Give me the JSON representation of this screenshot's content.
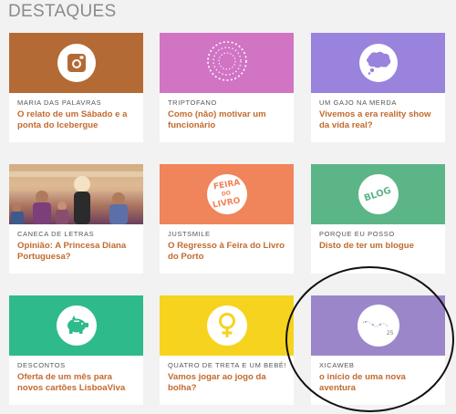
{
  "section": {
    "title": "DESTAQUES"
  },
  "colors": {
    "c1": "#b46a35",
    "c2": "#d174c4",
    "c3": "#9a83dd",
    "c5": "#f0845a",
    "c6": "#5cb586",
    "c7": "#2fba8b",
    "c8": "#f6d31f",
    "c9": "#9b86c9",
    "link": "#c26a2d"
  },
  "cards": [
    {
      "author": "MARIA DAS PALAVRAS",
      "title": "O relato de um Sábado e a ponta do Icebergue",
      "icon": "instagram-icon"
    },
    {
      "author": "TRIPTOFANO",
      "title": "Como (não) motivar um funcionário",
      "icon": "dotted-circle-icon"
    },
    {
      "author": "UM GAJO NA MERDA",
      "title": "Vivemos a era reality show da vida real?",
      "icon": "speech-bubble-icon"
    },
    {
      "author": "CANECA DE LETRAS",
      "title": "Opinião: A Princesa Diana Portuguesa?",
      "icon": "photo"
    },
    {
      "author": "JUSTSMILE",
      "title": "O Regresso à Feira do Livro do Porto",
      "icon": "feira-do-livro-logo",
      "logo_text": [
        "FEIRA",
        "DO",
        "LIVRO"
      ]
    },
    {
      "author": "PORQUE EU POSSO",
      "title": "Disto de ter um blogue",
      "icon": "blog-icon",
      "logo_text": "BLOG"
    },
    {
      "author": "DESCONTOS",
      "title": "Oferta de um mês para novos cartões LisboaViva",
      "icon": "piggy-bank-icon"
    },
    {
      "author": "QUATRO DE TRETA E UM BEBÉ!",
      "title": "Vamos jogar ao jogo da bolha?",
      "icon": "female-symbol-icon"
    },
    {
      "author": "XICAWEB",
      "title": "o início de uma nova aventura",
      "icon": "sketch-logo",
      "logo_text": "25"
    }
  ]
}
